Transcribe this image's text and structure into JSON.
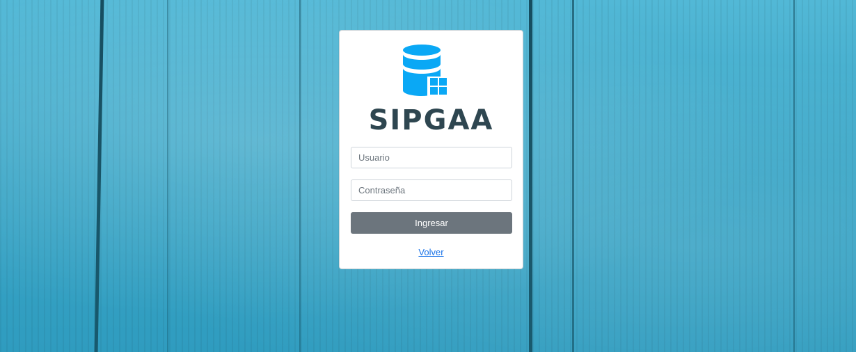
{
  "brand": {
    "name": "SIPGAA",
    "logo_icon": "database-windows-icon"
  },
  "login": {
    "username_placeholder": "Usuario",
    "password_placeholder": "Contraseña",
    "submit_label": "Ingresar",
    "back_link": "Volver"
  },
  "colors": {
    "accent": "#0aa8f5",
    "button": "#6c757d",
    "brand_text": "#2e4650",
    "link": "#1a73e8"
  }
}
